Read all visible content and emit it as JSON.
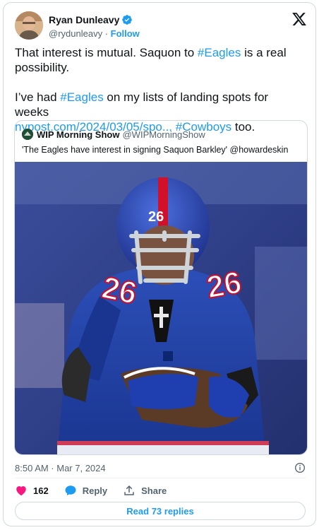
{
  "author": {
    "name": "Ryan Dunleavy",
    "handle": "@rydunleavy",
    "separator": " · ",
    "follow_label": "Follow"
  },
  "tweet": {
    "line1_pre": "That interest is mutual. Saquon to ",
    "line1_tag": "#Eagles",
    "line1_post": " is a real possibility.",
    "line2_pre": "I’ve had ",
    "line2_tag": "#Eagles",
    "line2_post": " on my lists of landing spots for weeks",
    "link": "nypost.com/2024/03/05/spo...",
    "tag3": "#Cowboys",
    "line3_post": " too."
  },
  "quote": {
    "name": "WIP Morning Show",
    "handle": "@WIPMorningShow",
    "text": "'The Eagles have interest in signing Saquon Barkley' @howardeskin",
    "jersey_number": "26"
  },
  "timestamp": "8:50 AM · Mar 7, 2024",
  "actions": {
    "likes": "162",
    "reply_label": "Reply",
    "share_label": "Share"
  },
  "read_replies_label": "Read 73 replies",
  "colors": {
    "accent": "#1d9bf0",
    "like": "#f91880",
    "text": "#0f1419",
    "muted": "#536471",
    "border": "#cfd9de"
  },
  "icons": [
    "verified-badge-icon",
    "x-logo-icon",
    "info-icon",
    "heart-icon",
    "reply-bubble-icon",
    "share-icon"
  ]
}
